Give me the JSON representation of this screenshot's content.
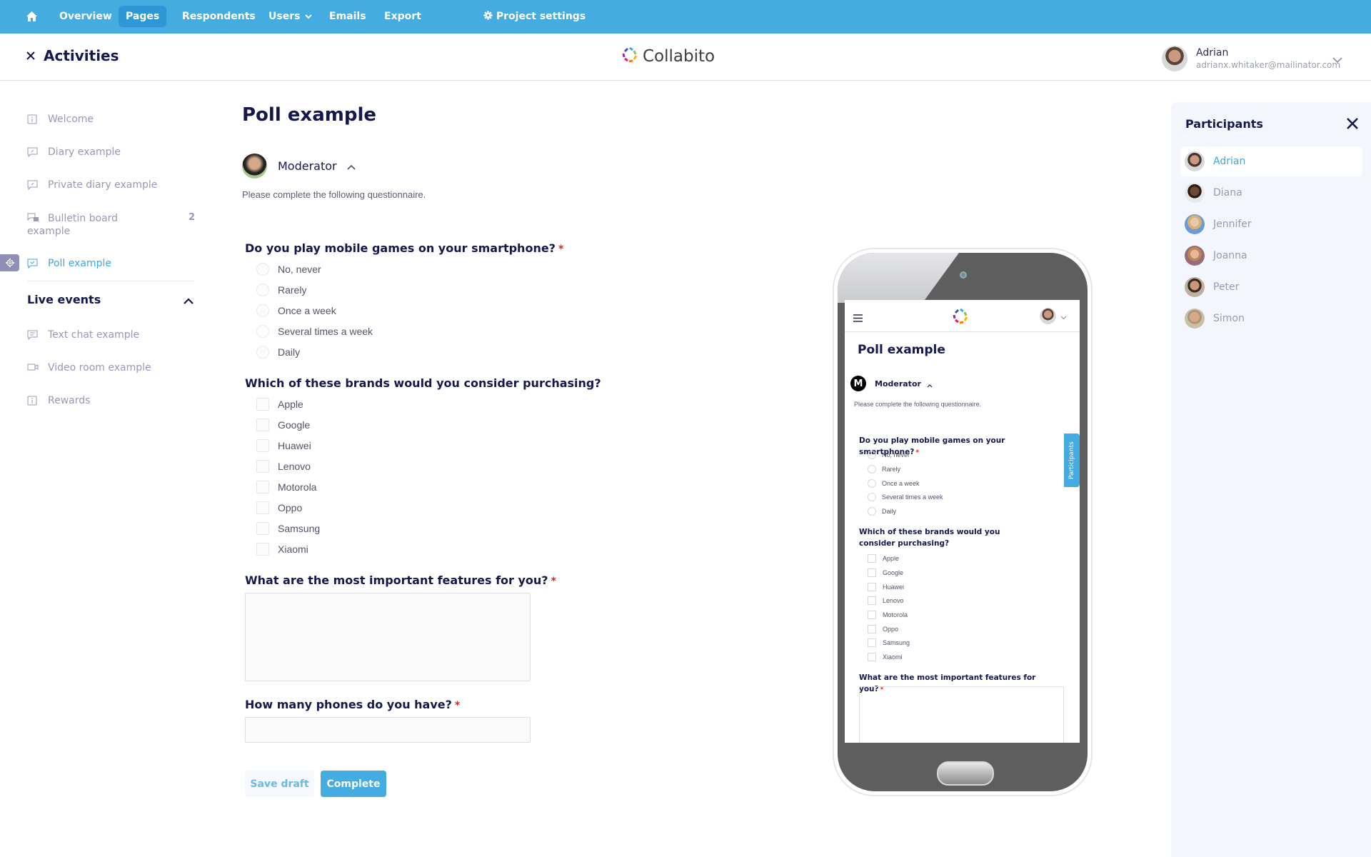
{
  "topnav": {
    "home_icon": "home-icon",
    "items": [
      {
        "label": "Overview",
        "active": false
      },
      {
        "label": "Pages",
        "active": true
      },
      {
        "label": "Respondents",
        "active": false
      },
      {
        "label": "Users",
        "active": false,
        "has_dropdown": true
      },
      {
        "label": "Emails",
        "active": false
      },
      {
        "label": "Export",
        "active": false
      }
    ],
    "settings_label": "Project settings",
    "accent_color": "#45ace2"
  },
  "header": {
    "title": "Activities",
    "logo_text": "Collabito",
    "user": {
      "name": "Adrian",
      "email": "adrianx.whitaker@mailinator.com"
    }
  },
  "sidebar": {
    "items": [
      {
        "label": "Welcome",
        "icon": "info-icon"
      },
      {
        "label": "Diary example",
        "icon": "edit-comment-icon"
      },
      {
        "label": "Private diary example",
        "icon": "edit-comment-icon"
      },
      {
        "label": "Bulletin board example",
        "icon": "forum-icon",
        "badge": "2"
      },
      {
        "label": "Poll example",
        "icon": "check-comment-icon",
        "active": true
      }
    ],
    "section": {
      "label": "Live events",
      "expanded": true,
      "items": [
        {
          "label": "Text chat example",
          "icon": "chat-icon"
        },
        {
          "label": "Video room example",
          "icon": "video-icon"
        },
        {
          "label": "Rewards",
          "icon": "info-icon"
        }
      ]
    }
  },
  "main": {
    "title": "Poll example",
    "moderator_label": "Moderator",
    "intro": "Please complete the following questionnaire.",
    "questions": [
      {
        "title": "Do you play mobile games on your smartphone?",
        "required": true,
        "type": "radio",
        "options": [
          "No, never",
          "Rarely",
          "Once a week",
          "Several times a week",
          "Daily"
        ]
      },
      {
        "title": "Which of these brands would you consider purchasing?",
        "required": false,
        "type": "checkbox",
        "options": [
          "Apple",
          "Google",
          "Huawei",
          "Lenovo",
          "Motorola",
          "Oppo",
          "Samsung",
          "Xiaomi"
        ]
      },
      {
        "title": "What are the most important features for you?",
        "required": true,
        "type": "textarea",
        "value": ""
      },
      {
        "title": "How many phones do you have?",
        "required": true,
        "type": "text",
        "value": ""
      }
    ],
    "required_mark": "*",
    "buttons": {
      "save_draft": "Save draft",
      "complete": "Complete"
    }
  },
  "phone_preview": {
    "title": "Poll example",
    "moderator_initial": "M",
    "moderator_label": "Moderator",
    "intro": "Please complete the following questionnaire.",
    "q1_title": "Do you play mobile games on your smartphone?",
    "q2_title": "Which of these brands would you consider purchasing?",
    "q3_title": "What are the most important features for you?",
    "participants_tab": "Participants"
  },
  "participants": {
    "title": "Participants",
    "items": [
      {
        "name": "Adrian",
        "active": true
      },
      {
        "name": "Diana",
        "active": false
      },
      {
        "name": "Jennifer",
        "active": false
      },
      {
        "name": "Joanna",
        "active": false
      },
      {
        "name": "Peter",
        "active": false
      },
      {
        "name": "Simon",
        "active": false
      }
    ]
  }
}
